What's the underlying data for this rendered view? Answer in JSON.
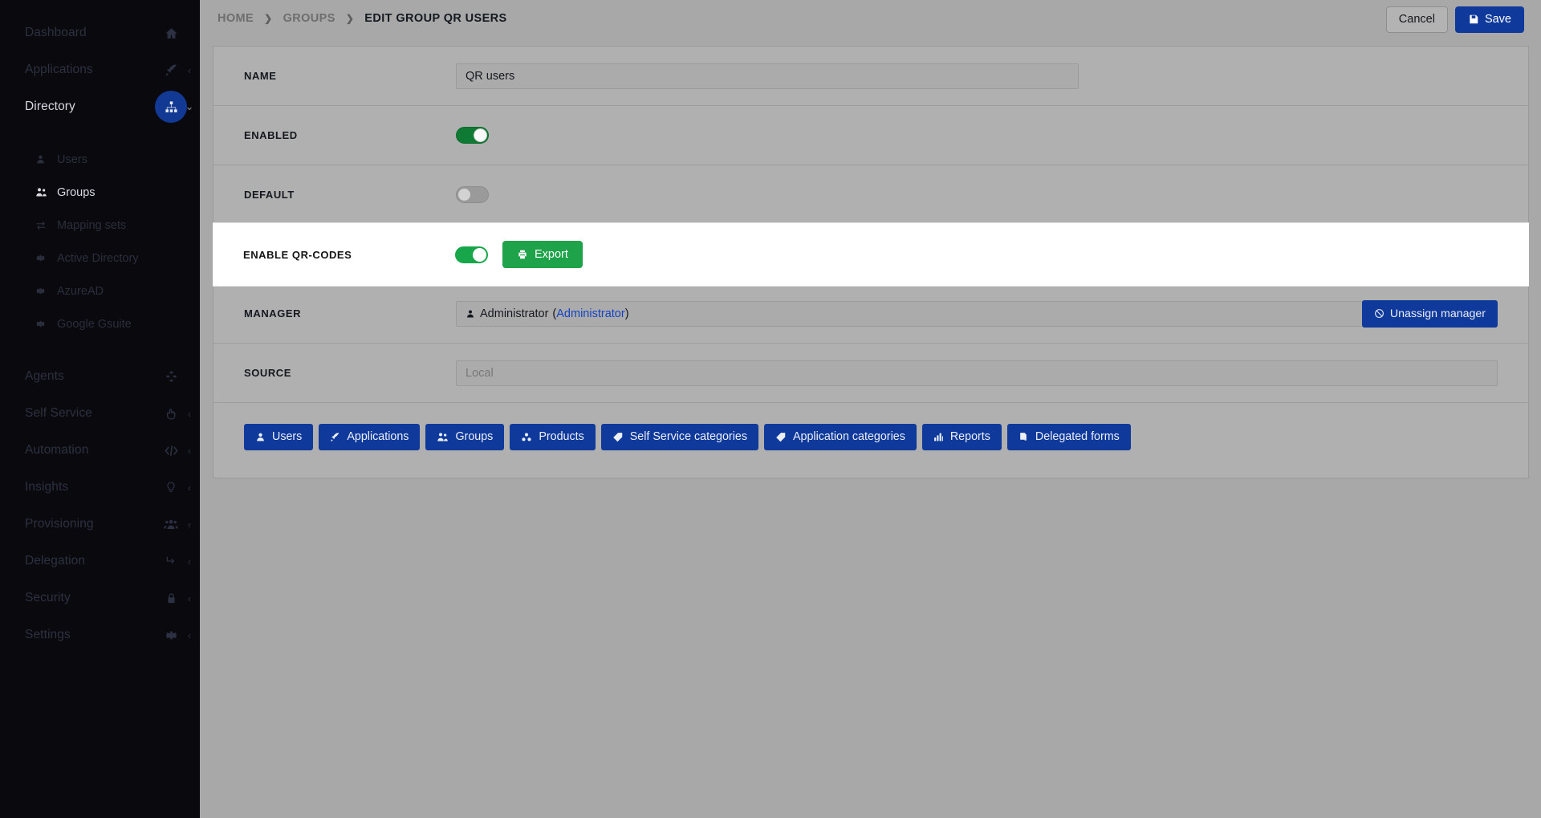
{
  "sidebar": {
    "items": [
      {
        "label": "Dashboard",
        "icon": "home-icon",
        "caret": "",
        "active": false,
        "type": "main"
      },
      {
        "label": "Applications",
        "icon": "rocket-icon",
        "caret": "‹",
        "active": false,
        "type": "main"
      },
      {
        "label": "Directory",
        "icon": "sitemap-icon",
        "caret": "⌄",
        "active": true,
        "type": "main"
      }
    ],
    "sub_items": [
      {
        "label": "Users",
        "icon": "user-icon",
        "selected": false
      },
      {
        "label": "Groups",
        "icon": "users-icon",
        "selected": true
      },
      {
        "label": "Mapping sets",
        "icon": "exchange-icon",
        "selected": false
      },
      {
        "label": "Active Directory",
        "icon": "gear-icon",
        "selected": false
      },
      {
        "label": "AzureAD",
        "icon": "gear-icon",
        "selected": false
      },
      {
        "label": "Google Gsuite",
        "icon": "gear-icon",
        "selected": false
      }
    ],
    "items_bottom": [
      {
        "label": "Agents",
        "icon": "cubes-icon",
        "caret": ""
      },
      {
        "label": "Self Service",
        "icon": "hand-icon",
        "caret": "‹"
      },
      {
        "label": "Automation",
        "icon": "code-icon",
        "caret": "‹"
      },
      {
        "label": "Insights",
        "icon": "bulb-icon",
        "caret": "‹"
      },
      {
        "label": "Provisioning",
        "icon": "usergroup-icon",
        "caret": "‹"
      },
      {
        "label": "Delegation",
        "icon": "arrow-turn-icon",
        "caret": "‹"
      },
      {
        "label": "Security",
        "icon": "lock-icon",
        "caret": "‹"
      },
      {
        "label": "Settings",
        "icon": "gear-icon",
        "caret": "‹"
      }
    ]
  },
  "topbar": {
    "breadcrumb": [
      "HOME",
      "GROUPS",
      "EDIT GROUP QR USERS"
    ],
    "separator": "❯",
    "cancel_label": "Cancel",
    "save_label": "Save"
  },
  "form": {
    "name": {
      "label": "NAME",
      "value": "QR users"
    },
    "enabled": {
      "label": "ENABLED",
      "state": "on"
    },
    "default": {
      "label": "DEFAULT",
      "state": "off"
    },
    "qrcodes": {
      "label": "ENABLE QR-CODES",
      "state": "on",
      "export_label": "Export"
    },
    "manager": {
      "label": "MANAGER",
      "value_name": "Administrator",
      "value_login": "Administrator",
      "open_paren": "(",
      "close_paren": ")",
      "unassign_label": "Unassign manager"
    },
    "source": {
      "label": "SOURCE",
      "value": "Local"
    }
  },
  "tabs": [
    {
      "label": "Users",
      "icon": "user-icon"
    },
    {
      "label": "Applications",
      "icon": "rocket-icon"
    },
    {
      "label": "Groups",
      "icon": "users-icon"
    },
    {
      "label": "Products",
      "icon": "cubes-icon"
    },
    {
      "label": "Self Service categories",
      "icon": "tag-icon"
    },
    {
      "label": "Application categories",
      "icon": "tag-icon"
    },
    {
      "label": "Reports",
      "icon": "chart-icon"
    },
    {
      "label": "Delegated forms",
      "icon": "copy-icon"
    }
  ],
  "colors": {
    "brand_blue": "#0f3a9b",
    "green": "#1ea34a",
    "toggle_on": "#0e7a33",
    "page_bg": "#a8a8a8",
    "sidebar_bg": "#0a0a0e",
    "highlight_bg": "#ffffff"
  }
}
